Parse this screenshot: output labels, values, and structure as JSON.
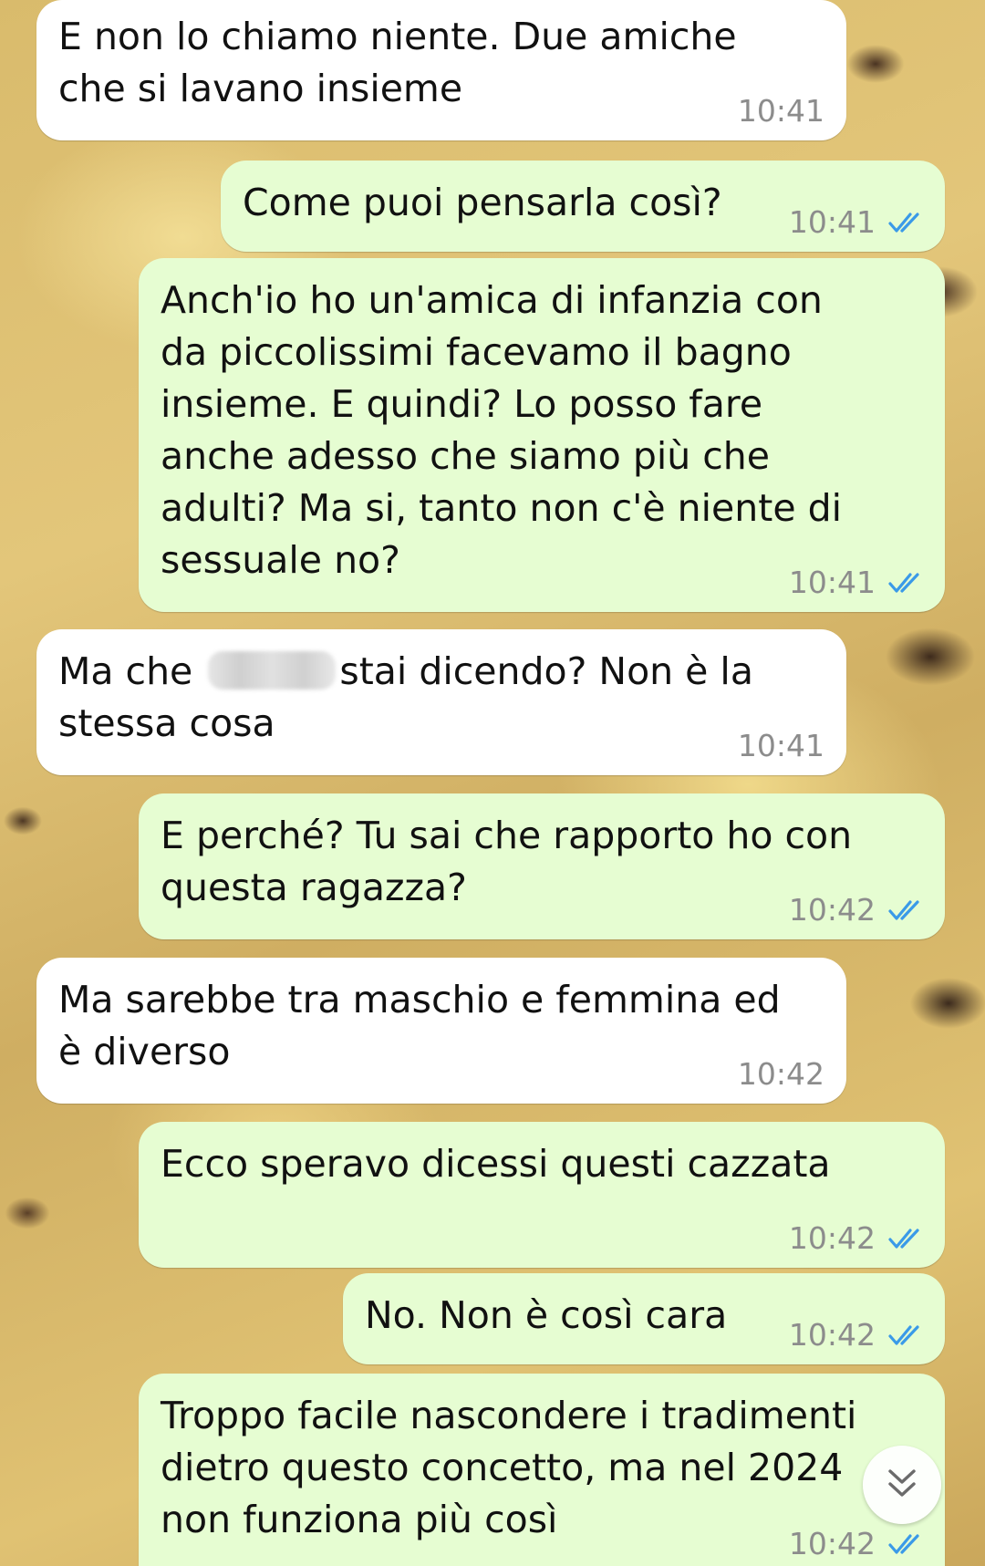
{
  "messages": [
    {
      "direction": "incoming",
      "text": "E non lo chiamo niente. Due amiche\nche si lavano insieme",
      "time": "10:41"
    },
    {
      "direction": "outgoing",
      "text": "Come puoi pensarla così?",
      "time": "10:41",
      "status": "read"
    },
    {
      "direction": "outgoing",
      "text": "Anch'io ho un'amica di infanzia con\nda piccolissimi facevamo il bagno\ninsieme. E quindi? Lo posso fare\nanche adesso che siamo più che\nadulti? Ma si, tanto non c'è niente di\nsessuale no?",
      "time": "10:41",
      "status": "read"
    },
    {
      "direction": "incoming",
      "text_before_redaction": "Ma che",
      "text_after_redaction": "stai dicendo? Non è la\nstessa cosa",
      "time": "10:41"
    },
    {
      "direction": "outgoing",
      "text": "E perché? Tu sai che rapporto ho con\nquesta ragazza?",
      "time": "10:42",
      "status": "read"
    },
    {
      "direction": "incoming",
      "text": "Ma sarebbe tra maschio e femmina ed\nè diverso",
      "time": "10:42"
    },
    {
      "direction": "outgoing",
      "text": "Ecco speravo dicessi questi cazzata",
      "time": "10:42",
      "status": "read"
    },
    {
      "direction": "outgoing",
      "text": "No. Non è così cara",
      "time": "10:42",
      "status": "read"
    },
    {
      "direction": "outgoing",
      "text": "Troppo facile nascondere i tradimenti\ndietro questo concetto, ma nel 2024\nnon funziona più così",
      "time": "10:42",
      "status": "read"
    }
  ],
  "icons": {
    "read_receipt": "double-check-icon",
    "scroll_down": "chevron-double-down-icon"
  },
  "colors": {
    "incoming_bubble": "#ffffff",
    "outgoing_bubble": "#e6fdd2",
    "time_text": "#8c8c8c",
    "read_ticks": "#3a9ae8"
  }
}
